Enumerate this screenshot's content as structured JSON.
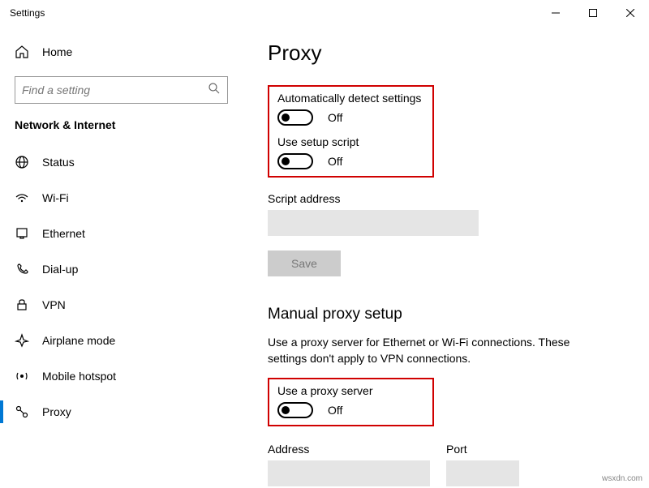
{
  "titlebar": {
    "title": "Settings"
  },
  "sidebar": {
    "home_label": "Home",
    "search_placeholder": "Find a setting",
    "category": "Network & Internet",
    "items": [
      {
        "label": "Status"
      },
      {
        "label": "Wi-Fi"
      },
      {
        "label": "Ethernet"
      },
      {
        "label": "Dial-up"
      },
      {
        "label": "VPN"
      },
      {
        "label": "Airplane mode"
      },
      {
        "label": "Mobile hotspot"
      },
      {
        "label": "Proxy"
      }
    ]
  },
  "content": {
    "page_title": "Proxy",
    "auto_detect_label": "Automatically detect settings",
    "auto_detect_state": "Off",
    "use_script_label": "Use setup script",
    "use_script_state": "Off",
    "script_address_label": "Script address",
    "save_label": "Save",
    "manual_section_title": "Manual proxy setup",
    "manual_section_desc": "Use a proxy server for Ethernet or Wi-Fi connections. These settings don't apply to VPN connections.",
    "use_proxy_label": "Use a proxy server",
    "use_proxy_state": "Off",
    "address_label": "Address",
    "port_label": "Port"
  },
  "watermark": "wsxdn.com"
}
